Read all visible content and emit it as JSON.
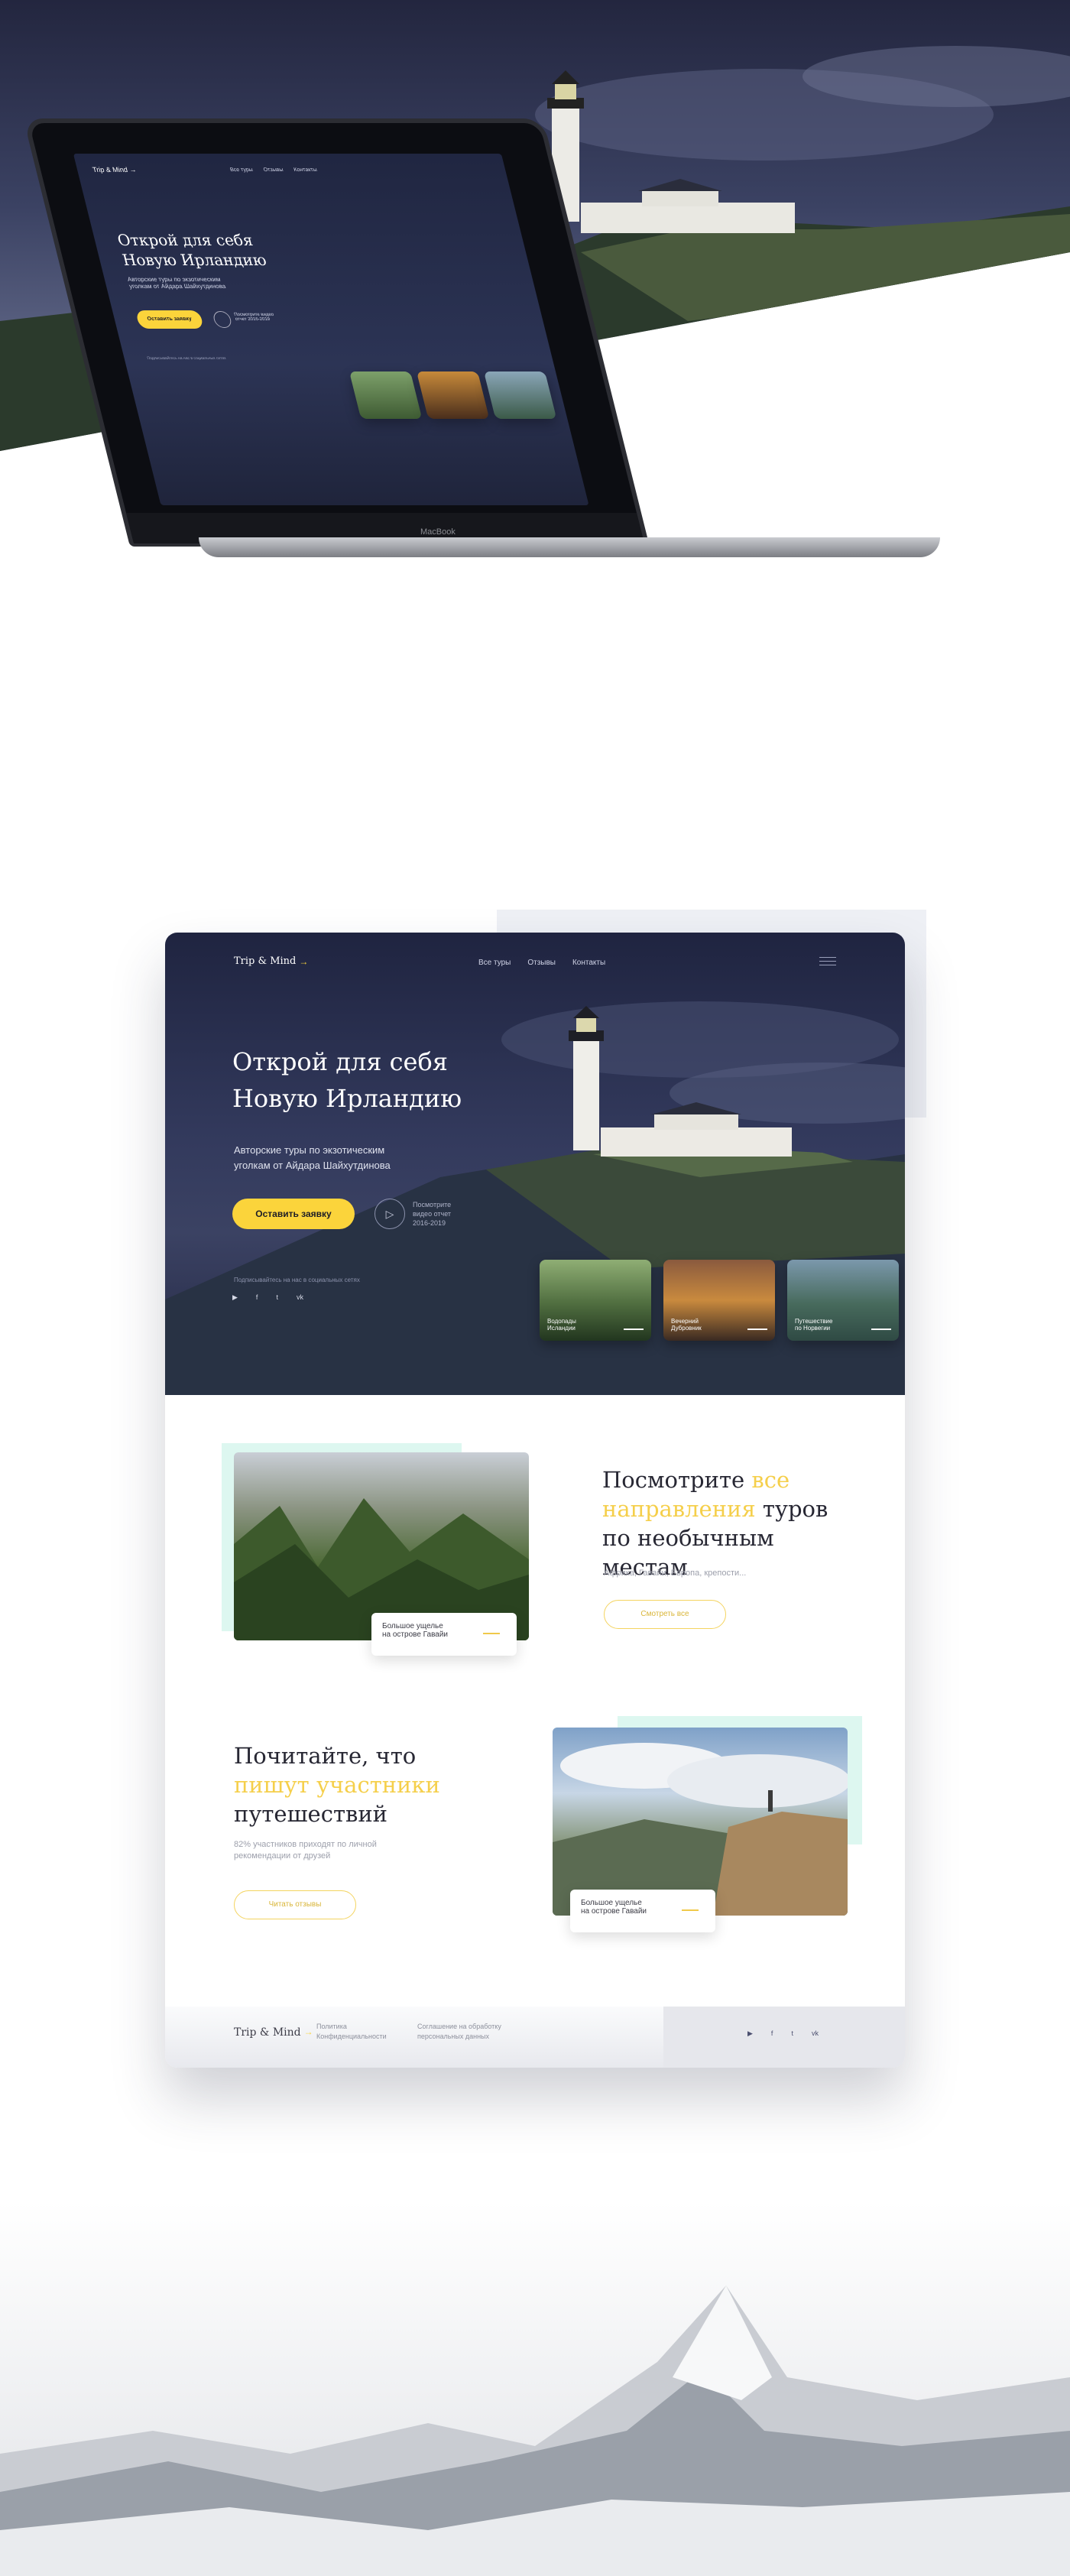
{
  "laptop": {
    "brand": "MacBook",
    "screen": {
      "logo": "Trip & Mind →",
      "nav": [
        "Все туры",
        "Отзывы",
        "Контакты"
      ],
      "title_line1": "Открой для себя",
      "title_line2": "Новую Ирландию",
      "subtitle": "Авторские туры по экзотическим уголкам от Айдара Шайхутдинова",
      "cta": "Оставить заявку",
      "video_text": "Посмотрите видео отчет 2016-2019",
      "social_label": "Подписывайтесь на нас в социальных сетях"
    }
  },
  "site": {
    "header": {
      "logo": "Trip & Mind",
      "logo_arrow": "→",
      "nav": [
        "Все туры",
        "Отзывы",
        "Контакты"
      ],
      "menu_icon": "hamburger-icon"
    },
    "hero": {
      "title_line1": "Открой для себя",
      "title_line2": "Новую Ирландию",
      "subtitle_line1": "Авторские туры по экзотическим",
      "subtitle_line2": "уголкам от Айдара Шайхутдинова",
      "cta_label": "Оставить заявку",
      "video_line1": "Посмотрите",
      "video_line2": "видео отчет",
      "video_line3": "2016-2019",
      "social_label": "Подписывайтесь на нас в социальных сетях",
      "social_icons": [
        "youtube-icon",
        "facebook-icon",
        "twitter-icon",
        "vk-icon"
      ],
      "cards": [
        {
          "line1": "Водопады",
          "line2": "Исландии"
        },
        {
          "line1": "Вечерний",
          "line2": "Дубровник"
        },
        {
          "line1": "Путешествие",
          "line2": "по Норвегии"
        }
      ]
    },
    "destinations": {
      "title_pre": "Посмотрите ",
      "title_hl1": "все",
      "title_hl2": "направления",
      "title_post": " туров",
      "title_line3": "по необычным местам",
      "tags": "Африка, Гавайи, Европа, крепости...",
      "button": "Смотреть все",
      "caption_line1": "Большое ущелье",
      "caption_line2": "на острове Гавайи"
    },
    "reviews": {
      "title_line1": "Почитайте, что",
      "title_hl": "пишут участники",
      "title_line3": "путешествий",
      "desc_line1": "82% участников приходят по личной",
      "desc_line2": "рекомендации от друзей",
      "button": "Читать отзывы",
      "caption_line1": "Большое ущелье",
      "caption_line2": "на острове Гавайи"
    },
    "footer": {
      "logo": "Trip & Mind",
      "logo_arrow": "→",
      "link1_line1": "Политика",
      "link1_line2": "Конфиденциальности",
      "link2_line1": "Соглашение на обработку",
      "link2_line2": "персональных данных",
      "social_icons": [
        "youtube-icon",
        "facebook-icon",
        "twitter-icon",
        "vk-icon"
      ]
    }
  },
  "colors": {
    "accent": "#fbd43b",
    "hero_dark": "#23283f",
    "mint": "#ddf7f0"
  }
}
